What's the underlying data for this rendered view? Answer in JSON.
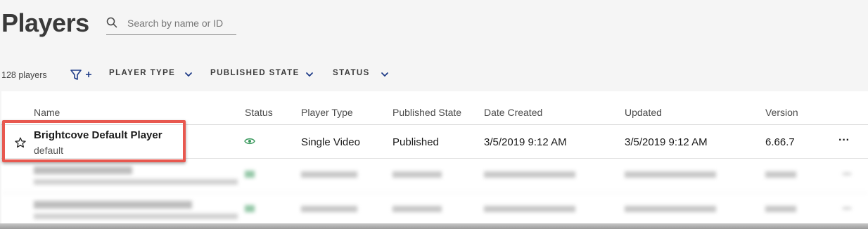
{
  "header": {
    "title": "Players"
  },
  "search": {
    "placeholder": "Search by name or ID"
  },
  "filters": {
    "count_label": "128 players",
    "dropdowns": [
      {
        "label": "PLAYER TYPE"
      },
      {
        "label": "PUBLISHED STATE"
      },
      {
        "label": "STATUS"
      }
    ]
  },
  "table": {
    "columns": [
      "Name",
      "Status",
      "Player Type",
      "Published State",
      "Date Created",
      "Updated",
      "Version"
    ],
    "rows": [
      {
        "name": "Brightcove Default Player",
        "id": "default",
        "status_icon": "eye-icon",
        "player_type": "Single Video",
        "published_state": "Published",
        "date_created": "3/5/2019 9:12 AM",
        "updated": "3/5/2019 9:12 AM",
        "version": "6.66.7",
        "menu": "···"
      }
    ]
  },
  "colors": {
    "accent": "#1f3c88",
    "highlight": "#e8584f",
    "status_ok": "#3c9a5f"
  }
}
